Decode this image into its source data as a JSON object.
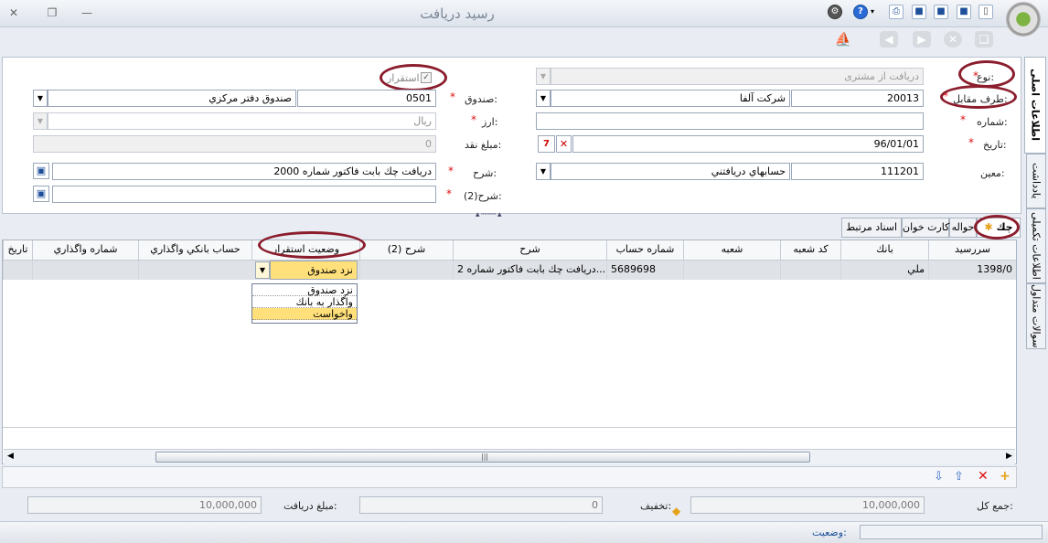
{
  "window": {
    "title": "رسید دریافت"
  },
  "header_fields": {
    "type_label": "نوع:",
    "type_value": "دریافت از مشتری",
    "counterparty_label": "طرف مقابل:",
    "counterparty_code": "20013",
    "counterparty_name": "شرکت آلفا",
    "number_label": "شماره:",
    "number_value": "",
    "date_label": "تاریخ:",
    "date_value": "96/01/01",
    "subsidiary_label": "معین:",
    "subsidiary_code": "111201",
    "subsidiary_name": "حسابهاي دريافتني",
    "settled_label": "استقرار",
    "cashbox_label": "صندوق:",
    "cashbox_code": "0501",
    "cashbox_name": "صندوق دفتر مرکزي",
    "currency_label": "ارز:",
    "currency_value": "ريال",
    "cash_amount_label": "مبلغ نقد:",
    "cash_amount_value": "0",
    "description_label": "شرح:",
    "description_value": "دریافت چك بابت فاکتور شماره 2000",
    "description2_label": "شرح(2):",
    "description2_value": ""
  },
  "side_tabs": [
    "اطلاعات اصلی",
    "یادداشت",
    "اطلاعات تکمیلی",
    "سوالات متداول"
  ],
  "grid_tabs": [
    "چك",
    "حواله",
    "كارت خوان",
    "اسناد مرتبط"
  ],
  "grid": {
    "columns": [
      "سررسید",
      "بانك",
      "كد شعبه",
      "شعبه",
      "شماره حساب",
      "شرح",
      "شرح (2)",
      "وضعيت استقرار",
      "حساب بانكي واگذاري",
      "شماره واگذاري",
      "تاريخ"
    ],
    "row": {
      "due_date": "1398/0",
      "bank": "ملي",
      "branch_code": "",
      "branch": "",
      "account_number": "5689698",
      "description": "دریافت چك بابت فاکتور شماره 2...",
      "description2": "",
      "status": "نزد صندوق",
      "bank_account": "",
      "assign_number": "",
      "date": ""
    },
    "status_options": [
      "نزد صندوق",
      "واگذار به بانك",
      "واخواست"
    ],
    "selected_option": "واخواست"
  },
  "footer": {
    "total_label": "جمع كل:",
    "total_value": "10,000,000",
    "discount_label": "تخفیف:",
    "discount_value": "0",
    "received_label": "مبلغ دریافت:",
    "received_value": "10,000,000"
  },
  "status_bar": {
    "label": "وضعیت:"
  },
  "colors": {
    "highlight_oval": "#8b1d2c",
    "required": "#d11111",
    "selected_option": "#ffe07a"
  }
}
